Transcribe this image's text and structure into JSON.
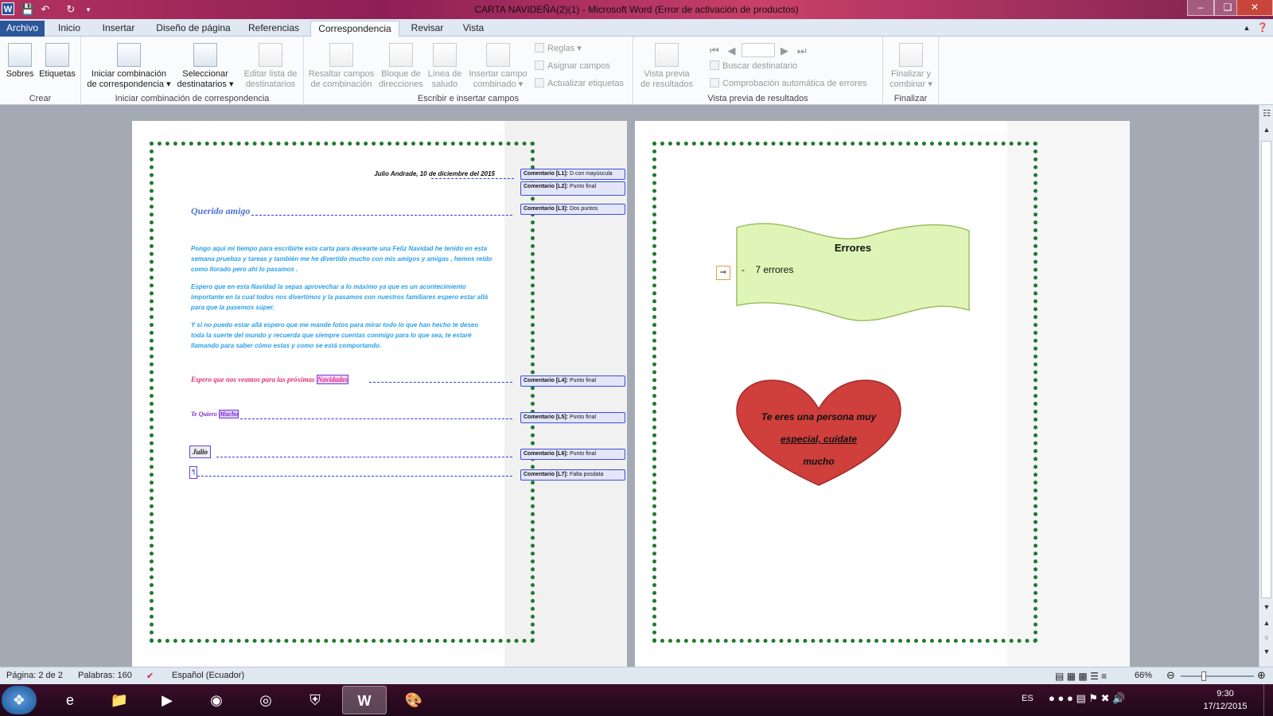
{
  "window": {
    "title": "CARTA NAVIDEÑA(2)(1)  -  Microsoft Word (Error de activación de productos)"
  },
  "icons": {
    "app": "word-logo-icon",
    "save": "save-icon",
    "undo": "undo-icon",
    "redo": "redo-icon"
  },
  "tabs": [
    {
      "label": "Archivo"
    },
    {
      "label": "Inicio"
    },
    {
      "label": "Insertar"
    },
    {
      "label": "Diseño de página"
    },
    {
      "label": "Referencias"
    },
    {
      "label": "Correspondencia"
    },
    {
      "label": "Revisar"
    },
    {
      "label": "Vista"
    }
  ],
  "ribbon": {
    "crear": {
      "label": "Crear",
      "sobres": "Sobres",
      "etiquetas": "Etiquetas"
    },
    "iniciar": {
      "label": "Iniciar combinación de correspondencia",
      "iniciar_1": "Iniciar combinación",
      "iniciar_2": "de correspondencia",
      "seleccionar_1": "Seleccionar",
      "seleccionar_2": "destinatarios",
      "editar_1": "Editar lista de",
      "editar_2": "destinatarios"
    },
    "escribir": {
      "label": "Escribir e insertar campos",
      "resaltar_1": "Resaltar campos",
      "resaltar_2": "de combinación",
      "bloque_1": "Bloque de",
      "bloque_2": "direcciones",
      "linea_1": "Línea de",
      "linea_2": "saludo",
      "insertar_1": "Insertar campo",
      "insertar_2": "combinado",
      "reglas": "Reglas",
      "asignar": "Asignar campos",
      "actualizar": "Actualizar etiquetas"
    },
    "vista": {
      "label": "Vista previa de resultados",
      "vista_1": "Vista previa",
      "vista_2": "de resultados",
      "buscar": "Buscar destinatario",
      "comprobacion": "Comprobación automática de errores"
    },
    "finalizar": {
      "label": "Finalizar",
      "fin_1": "Finalizar y",
      "fin_2": "combinar"
    }
  },
  "letter": {
    "date": "Julio Andrade, 10 de diciembre del 2015",
    "greeting": "Querido amigo",
    "p1": "Pongo aquí mi tiempo para escribirte esta carta para desearte una Feliz Navidad he tenido en esta semana pruebas y tareas  y también me he divertido mucho con mis amigos y amigas , hemos reído como llorado pero ahí lo pasamos .",
    "p2": "Espero que en esta Navidad la sepas aprovechar a lo máximo ya que es un acontecimiento importante en la cual todos nos divertimos y la pasamos con nuestros familiares  espero estar allá para que la pasemos súper.",
    "p3": "Y si no puedo estar allá espero que me mande fotos  para mirar todo lo que han hecho  te deseo toda la suerte del mundo y recuerda que siempre cuentas conmigo para lo que sea, te estaré llamando para saber cómo estas y como se está comportando.",
    "closing_1": "Espero que nos veamos para las próximas",
    "closing_2": "Navidades",
    "love_1": "Te Quiero",
    "love_2": "Mucho",
    "signature": "Julio",
    "cursor": "¶"
  },
  "comments": [
    {
      "tag": "Comentario [L1]:",
      "text": "D con mayúscula"
    },
    {
      "tag": "Comentario [L2]:",
      "text": "Punto final"
    },
    {
      "tag": "Comentario [L3]:",
      "text": "Dos puntos"
    },
    {
      "tag": "Comentario [L4]:",
      "text": "Punto final"
    },
    {
      "tag": "Comentario [L5]:",
      "text": "Punto final"
    },
    {
      "tag": "Comentario [L6]:",
      "text": "Punto final"
    },
    {
      "tag": "Comentario [L7]:",
      "text": "Falta posdata"
    }
  ],
  "page2": {
    "banner_title": "Errores",
    "banner_item": "-    7 errores",
    "heart_1": "Te eres una persona muy",
    "heart_2": "especial, cuídate",
    "heart_3": "mucho"
  },
  "status": {
    "page": "Página: 2 de 2",
    "words": "Palabras: 160",
    "language": "Español (Ecuador)",
    "zoom": "66%"
  },
  "taskbar": {
    "lang": "ES",
    "time": "9:30",
    "date": "17/12/2015"
  },
  "colors": {
    "accent": "#2b579a",
    "frame": "#1f7a2e",
    "letter_blue": "#2aa1e6",
    "closing_pink": "#e0307a",
    "comment_blue": "#3a4fd8"
  }
}
